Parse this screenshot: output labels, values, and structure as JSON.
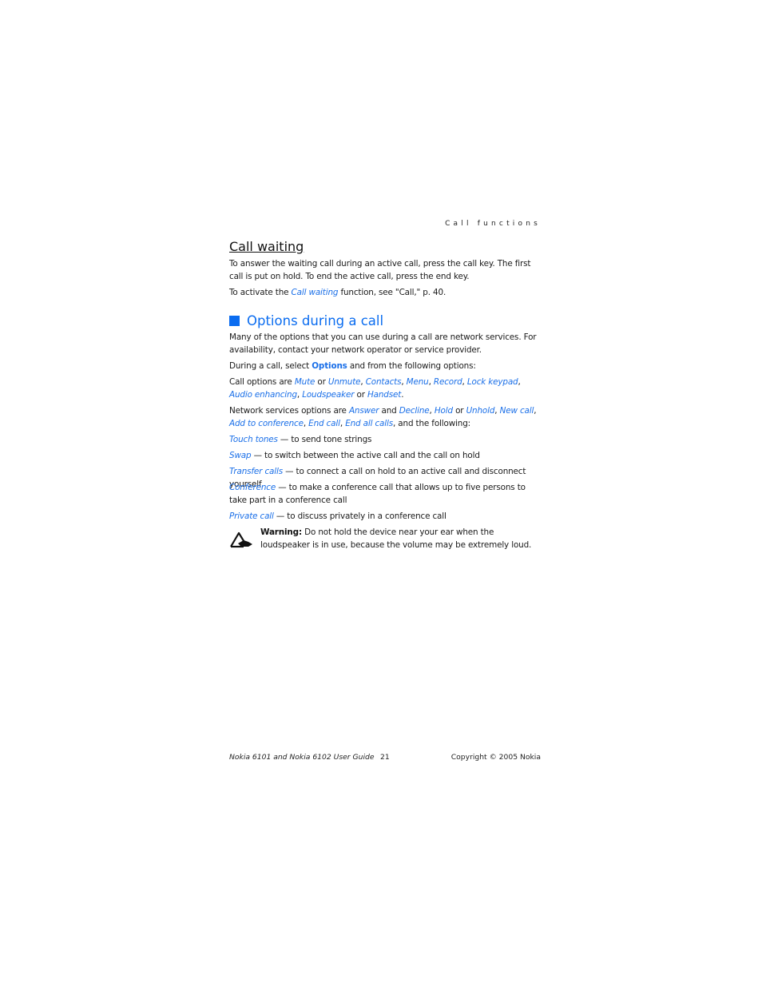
{
  "running_head": "Call functions",
  "call_waiting": {
    "title": "Call waiting",
    "para1": "To answer the waiting call during an active call, press the call key. The first call is put on hold. To end the active call, press the end key.",
    "para2_before": "To activate the ",
    "para2_link": "Call waiting",
    "para2_after": " function, see \"Call,\" p. 40."
  },
  "options": {
    "title": "Options during a call",
    "intro": "Many of the options that you can use during a call are network services. For availability, contact your network operator or service provider.",
    "select_before": "During a call, select ",
    "select_menu": "Options",
    "select_after": " and from the following options:",
    "call_options_prefix": "Call options are ",
    "call_options": [
      "Mute",
      "Unmute",
      "Contacts",
      "Menu",
      "Record",
      "Lock keypad",
      "Audio enhancing",
      "Loudspeaker",
      "Handset"
    ],
    "network_prefix": "Network services options are ",
    "network_options": [
      "Answer",
      "Decline",
      "Hold",
      "Unhold",
      "New call",
      "Add to conference",
      "End call",
      "End all calls"
    ],
    "network_suffix": ", and the following:",
    "items": [
      {
        "term": "Touch tones",
        "desc": " — to send tone strings"
      },
      {
        "term": "Swap",
        "desc": " — to switch between the active call and the call on hold"
      },
      {
        "term": "Transfer calls",
        "desc": " — to connect a call on hold to an active call and disconnect yourself"
      },
      {
        "term": "Conference",
        "desc": " — to make a conference call that allows up to five persons to take part in a conference call"
      },
      {
        "term": "Private call",
        "desc": " — to discuss privately in a conference call"
      }
    ]
  },
  "warning": {
    "label": "Warning:",
    "text": " Do not hold the device near your ear when the loudspeaker is in use, because the volume may be extremely loud."
  },
  "footer": {
    "guide": "Nokia 6101 and Nokia 6102 User Guide",
    "page": "21",
    "copyright": "Copyright © 2005 Nokia"
  },
  "colors": {
    "link": "#1a6fe8",
    "heading": "#0a6cf0"
  }
}
